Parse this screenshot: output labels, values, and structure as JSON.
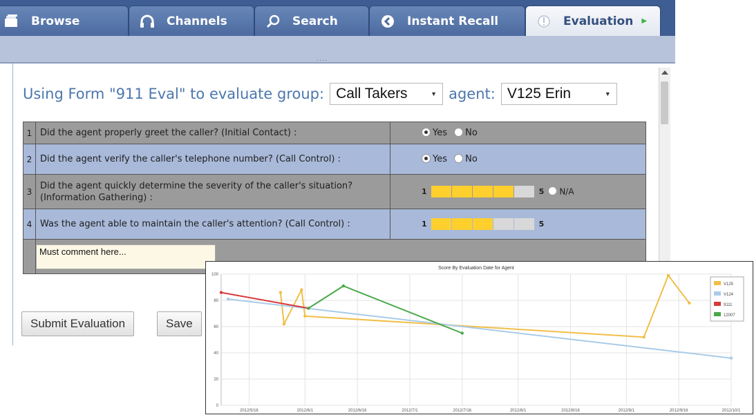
{
  "tabs": [
    {
      "label": "Browse",
      "icon": "browse-icon",
      "active": false
    },
    {
      "label": "Channels",
      "icon": "headphones-icon",
      "active": false
    },
    {
      "label": "Search",
      "icon": "search-icon",
      "active": false
    },
    {
      "label": "Instant Recall",
      "icon": "recall-icon",
      "active": false
    },
    {
      "label": "Evaluation",
      "icon": "info-icon",
      "active": true
    }
  ],
  "heading": {
    "prefix": "Using Form \"911 Eval\" to evaluate group:",
    "group_value": "Call Takers",
    "agent_label": "agent:",
    "agent_value": "V125 Erin"
  },
  "questions": [
    {
      "num": "1",
      "text": "Did the agent properly greet the caller? (Initial Contact) :",
      "type": "yesno",
      "yes_label": "Yes",
      "no_label": "No",
      "selected": "Yes"
    },
    {
      "num": "2",
      "text": "Did the agent verify the caller's telephone number? (Call Control) :",
      "type": "yesno",
      "yes_label": "Yes",
      "no_label": "No",
      "selected": "Yes"
    },
    {
      "num": "3",
      "text": "Did the agent quickly determine the severity of the caller's situation? (Information Gathering) :",
      "type": "scale",
      "min_label": "1",
      "max_label": "5",
      "value": 4,
      "na_label": "N/A"
    },
    {
      "num": "4",
      "text": "Was the agent able to maintain the caller's attention? (Call Control) :",
      "type": "scale",
      "min_label": "1",
      "max_label": "5",
      "value": 3
    }
  ],
  "comment": {
    "value": "Must comment here..."
  },
  "buttons": {
    "submit": "Submit Evaluation",
    "save": "Save"
  },
  "colors": {
    "tabbar": "#3e5e93",
    "heading": "#4c77ad",
    "rating": "#ffcf2e"
  },
  "chart_data": {
    "type": "line",
    "title": "Score By Evaluation Date for Agent",
    "ylim": [
      0,
      100
    ],
    "yticks": [
      "0",
      "20",
      "40",
      "60",
      "80",
      "100"
    ],
    "xlim": [
      "2012-05-08",
      "2012-10-01"
    ],
    "xticks": [
      "2012/5/16",
      "2012/6/1",
      "2012/6/16",
      "2012/7/1",
      "2012/7/16",
      "2012/8/1",
      "2012/8/16",
      "2012/9/1",
      "2012/9/16",
      "2012/10/1"
    ],
    "xtick_dates": [
      "2012-05-16",
      "2012-06-01",
      "2012-06-16",
      "2012-07-01",
      "2012-07-16",
      "2012-08-01",
      "2012-08-16",
      "2012-09-01",
      "2012-09-16",
      "2012-10-01"
    ],
    "grid": true,
    "legend_position": "top-right",
    "series": [
      {
        "name": "V125",
        "color": "#f0bf48",
        "points": [
          [
            "2012-05-25",
            86
          ],
          [
            "2012-05-26",
            62
          ],
          [
            "2012-05-31",
            88
          ],
          [
            "2012-06-01",
            68
          ],
          [
            "2012-09-06",
            52
          ],
          [
            "2012-09-13",
            99
          ],
          [
            "2012-09-19",
            78
          ]
        ]
      },
      {
        "name": "V124",
        "color": "#a9cbe7",
        "points": [
          [
            "2012-05-10",
            81
          ],
          [
            "2012-10-01",
            36
          ]
        ]
      },
      {
        "name": "9111",
        "color": "#d83a3a",
        "points": [
          [
            "2012-05-08",
            86
          ],
          [
            "2012-06-02",
            74
          ]
        ]
      },
      {
        "name": "12007",
        "color": "#4aa84a",
        "points": [
          [
            "2012-06-02",
            74
          ],
          [
            "2012-06-12",
            91
          ],
          [
            "2012-07-16",
            55
          ]
        ]
      }
    ]
  }
}
